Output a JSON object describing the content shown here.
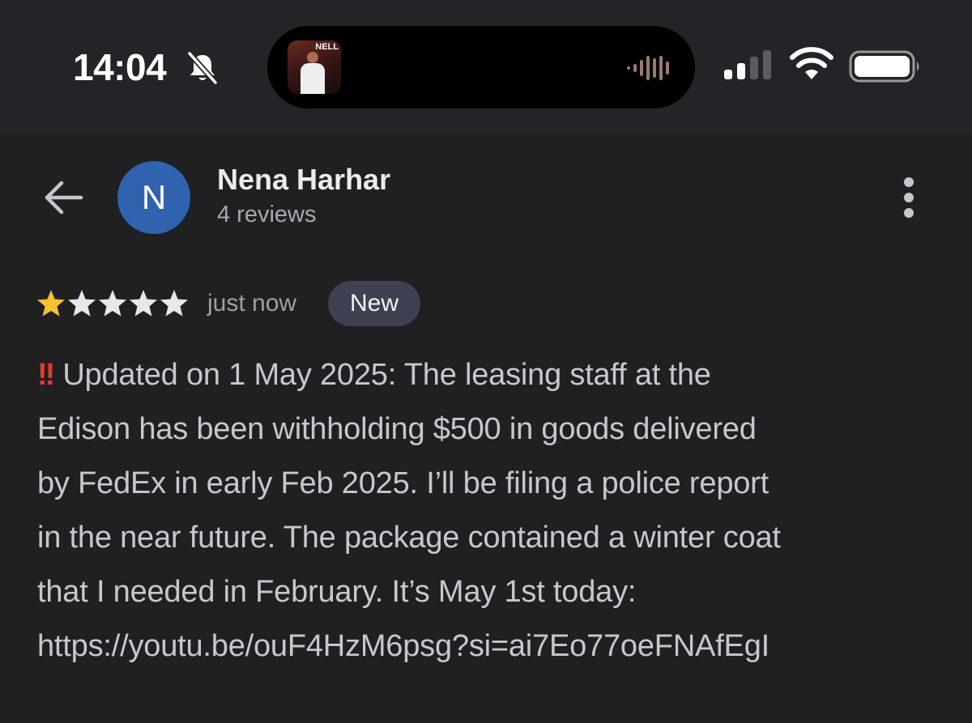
{
  "status_bar": {
    "time": "14:04",
    "album_art_text": "NELL"
  },
  "header": {
    "avatar_letter": "N",
    "name": "Nena Harhar",
    "reviews_count": "4 reviews"
  },
  "review": {
    "rating": 1,
    "max_rating": 5,
    "time_ago": "just now",
    "badge": "New",
    "icon": "double-exclamation-icon",
    "lines": [
      "Updated on 1 May 2025: The leasing staff at the",
      "Edison has been withholding $500 in goods delivered",
      "by FedEx in early Feb 2025. I’ll be filing a police report",
      "in the near future. The package contained a winter coat",
      "that I needed in February. It’s May 1st today:",
      "https://youtu.be/ouF4HzM6psg?si=ai7Eo77oeFNAfEgI"
    ]
  },
  "colors": {
    "star_filled": "#f6c230",
    "star_empty": "#e8e8ea",
    "avatar_bg": "#2f63b0",
    "badge_bg": "#3d4152",
    "alert_red": "#e23b2e"
  }
}
